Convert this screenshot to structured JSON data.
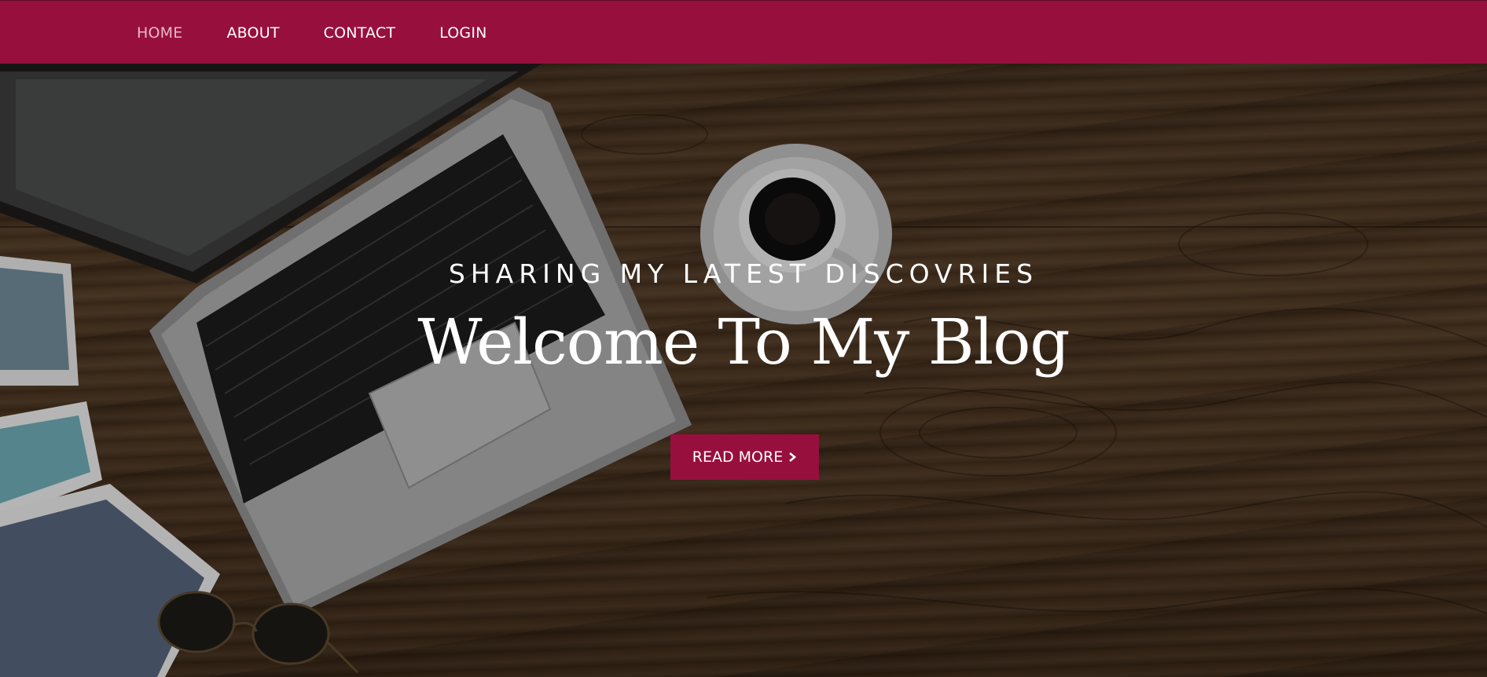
{
  "nav": {
    "items": [
      {
        "label": "HOME",
        "active": true
      },
      {
        "label": "ABOUT",
        "active": false
      },
      {
        "label": "CONTACT",
        "active": false
      },
      {
        "label": "LOGIN",
        "active": false
      }
    ]
  },
  "hero": {
    "subtitle": "SHARING MY LATEST DISCOVRIES",
    "title": "Welcome To My Blog",
    "button_label": "READ MORE",
    "button_icon": "chevron-right-icon"
  },
  "colors": {
    "brand": "#970f3c",
    "nav_active_text": "#e8b9c6",
    "text": "#ffffff"
  }
}
